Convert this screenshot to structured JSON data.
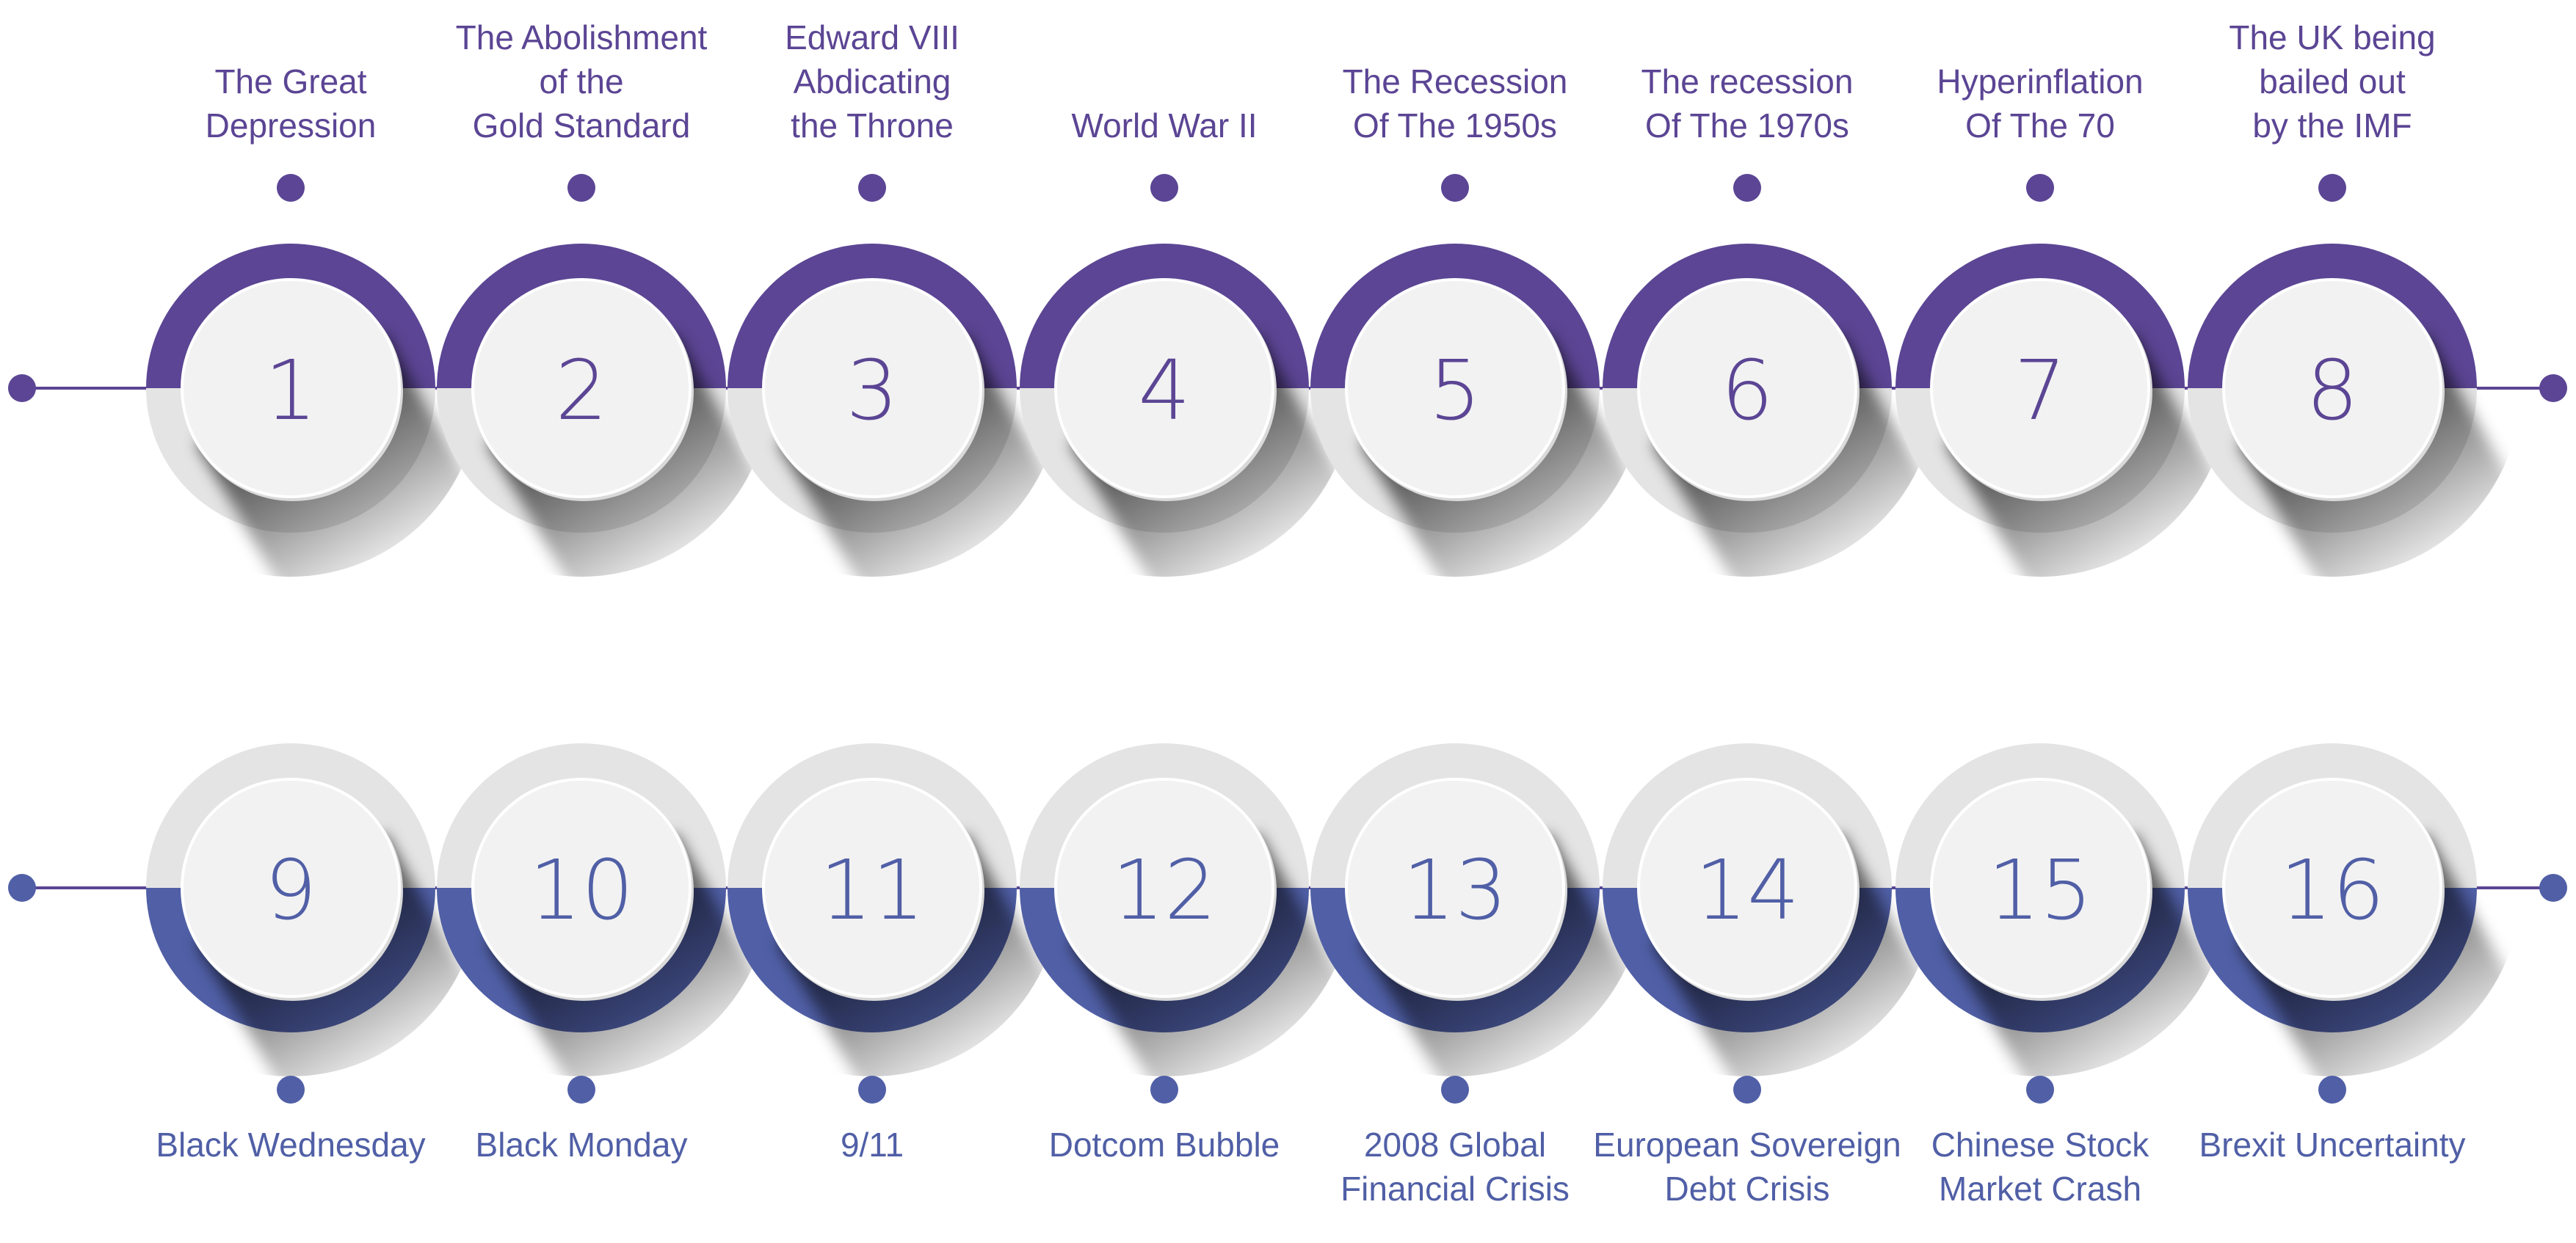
{
  "colors": {
    "row1_accent": "#5B4594",
    "row2_accent": "#505FA6",
    "ring_grey": "#E4E4E4",
    "disc": "#F2F2F2",
    "background": "#FFFFFF"
  },
  "rows": [
    {
      "accent_position": "top",
      "label_position": "above",
      "items": [
        {
          "number": "1",
          "label": [
            "The Great",
            "Depression"
          ]
        },
        {
          "number": "2",
          "label": [
            "The Abolishment",
            "of the",
            "Gold Standard"
          ]
        },
        {
          "number": "3",
          "label": [
            "Edward VIII",
            "Abdicating",
            "the Throne"
          ]
        },
        {
          "number": "4",
          "label": [
            "World War II"
          ]
        },
        {
          "number": "5",
          "label": [
            "The Recession",
            "Of The 1950s"
          ]
        },
        {
          "number": "6",
          "label": [
            "The recession",
            "Of The 1970s"
          ]
        },
        {
          "number": "7",
          "label": [
            "Hyperinflation",
            "Of The 70"
          ]
        },
        {
          "number": "8",
          "label": [
            "The UK being",
            "bailed out",
            "by the IMF"
          ]
        }
      ]
    },
    {
      "accent_position": "bottom",
      "label_position": "below",
      "items": [
        {
          "number": "9",
          "label": [
            "Black Wednesday"
          ]
        },
        {
          "number": "10",
          "label": [
            "Black Monday"
          ]
        },
        {
          "number": "11",
          "label": [
            "9/11"
          ]
        },
        {
          "number": "12",
          "label": [
            "Dotcom Bubble"
          ]
        },
        {
          "number": "13",
          "label": [
            "2008 Global",
            "Financial Crisis"
          ]
        },
        {
          "number": "14",
          "label": [
            "European Sovereign",
            "Debt Crisis"
          ]
        },
        {
          "number": "15",
          "label": [
            "Chinese Stock",
            "Market Crash"
          ]
        },
        {
          "number": "16",
          "label": [
            "Brexit Uncertainty"
          ]
        }
      ]
    }
  ]
}
